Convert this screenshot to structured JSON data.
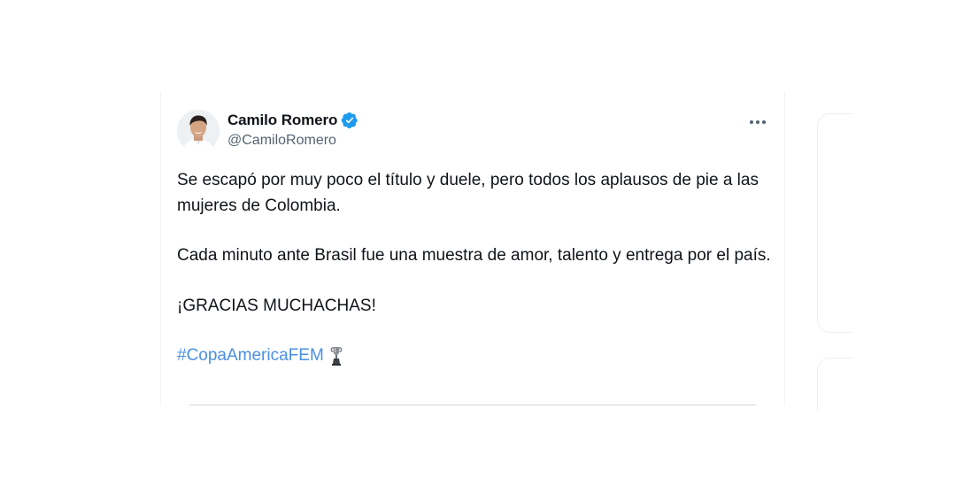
{
  "tweet": {
    "author": {
      "display_name": "Camilo Romero",
      "handle": "@CamiloRomero",
      "verified": true,
      "verified_color": "#1d9bf0"
    },
    "paragraphs": [
      "Se escapó por muy poco el título y duele, pero todos los aplausos de pie a las mujeres de Colombia.",
      "Cada minuto ante Brasil fue una muestra de amor, talento y entrega por el país.",
      "¡GRACIAS MUCHACHAS!"
    ],
    "hashtag": "#CopaAmericaFEM",
    "hashtag_emoji": "trophy-icon",
    "more_icon": "more-horizontal-icon",
    "link_color": "#4a90e2",
    "text_color": "#0f1419",
    "secondary_color": "#536471"
  }
}
